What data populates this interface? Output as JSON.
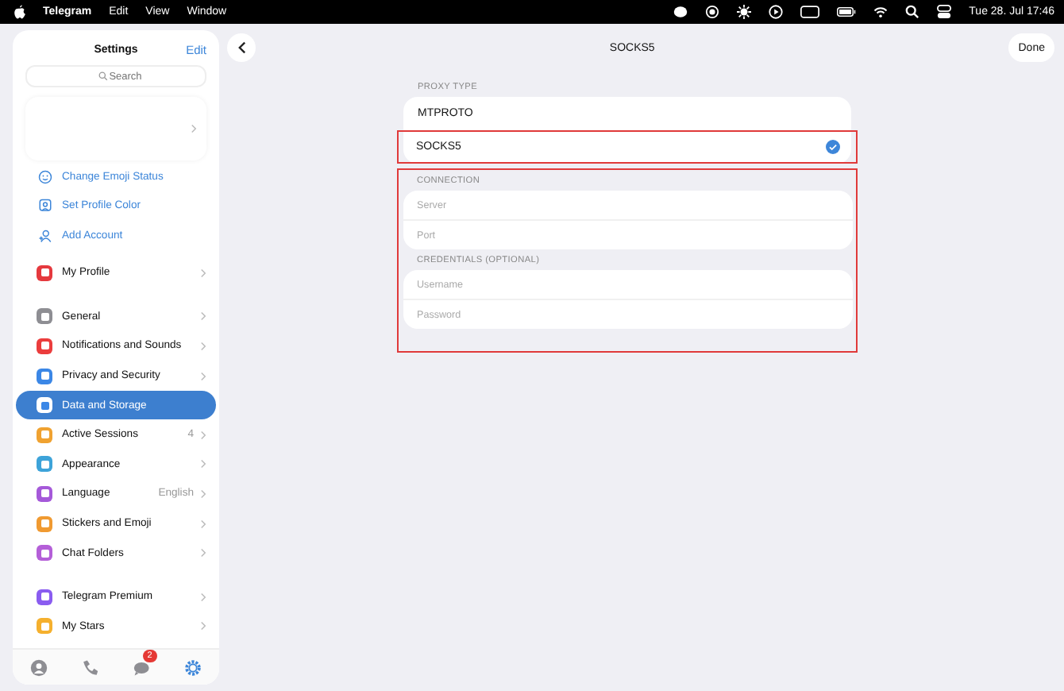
{
  "menubar": {
    "app": "Telegram",
    "menus": [
      "Edit",
      "View",
      "Window"
    ],
    "clock": "Tue 28. Jul  17:46"
  },
  "sidebar": {
    "title": "Settings",
    "edit": "Edit",
    "search": {
      "placeholder": "Search"
    },
    "actions": [
      {
        "label": "Change Emoji Status",
        "kind": "emoji"
      },
      {
        "label": "Set Profile Color",
        "kind": "color"
      },
      {
        "label": "Add Account",
        "kind": "account"
      }
    ],
    "groups": [
      [
        {
          "label": "My Profile",
          "color": "#e5393e",
          "selected": false
        }
      ],
      [
        {
          "label": "General",
          "color": "#8e8e93",
          "selected": false
        },
        {
          "label": "Notifications and Sounds",
          "color": "#eb3d3d",
          "selected": false
        },
        {
          "label": "Privacy and Security",
          "color": "#3b87e6",
          "selected": false
        },
        {
          "label": "Data and Storage",
          "color": "#3b87e6",
          "selected": true
        },
        {
          "label": "Active Sessions",
          "color": "#f0a231",
          "selected": false,
          "value": "4"
        },
        {
          "label": "Appearance",
          "color": "#3da3d9",
          "selected": false
        },
        {
          "label": "Language",
          "color": "#a559d9",
          "selected": false,
          "value": "English"
        },
        {
          "label": "Stickers and Emoji",
          "color": "#f09a31",
          "selected": false
        },
        {
          "label": "Chat Folders",
          "color": "#b45fd8",
          "selected": false
        }
      ],
      [
        {
          "label": "Telegram Premium",
          "color": "#8a5cf0",
          "selected": false
        },
        {
          "label": "My Stars",
          "color": "#f5b02e",
          "selected": false
        }
      ]
    ],
    "tabbar": [
      {
        "kind": "contacts",
        "selected": false
      },
      {
        "kind": "calls",
        "selected": false
      },
      {
        "kind": "chats",
        "selected": false,
        "badge": "2"
      },
      {
        "kind": "settings",
        "selected": true
      }
    ]
  },
  "main": {
    "title": "SOCKS5",
    "done": "Done",
    "proxy_type": {
      "header": "PROXY TYPE",
      "options": [
        {
          "label": "MTPROTO",
          "selected": false
        },
        {
          "label": "SOCKS5",
          "selected": true
        }
      ]
    },
    "sections": [
      {
        "header": "CONNECTION",
        "fields": [
          {
            "placeholder": "Server"
          },
          {
            "placeholder": "Port"
          }
        ]
      },
      {
        "header": "CREDENTIALS (OPTIONAL)",
        "fields": [
          {
            "placeholder": "Username"
          },
          {
            "placeholder": "Password"
          }
        ]
      }
    ]
  }
}
